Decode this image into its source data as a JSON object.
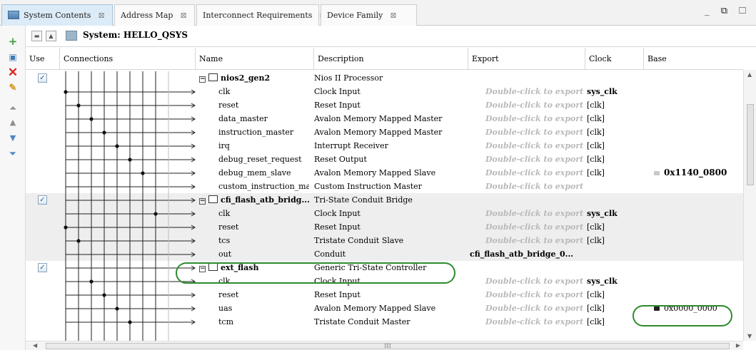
{
  "tabs": [
    {
      "label": "System Contents",
      "close": "⊠"
    },
    {
      "label": "Address Map",
      "close": "⊠"
    },
    {
      "label": "Interconnect Requirements",
      "close": "⊠"
    },
    {
      "label": "Device Family",
      "close": "⊠"
    }
  ],
  "window_controls": "_ ⧉ ☐",
  "system": {
    "label": "System: HELLO_QSYS"
  },
  "toolbar_icons": [
    "add-icon",
    "add-component-icon",
    "remove-icon",
    "edit-icon",
    "move-to-top-icon",
    "move-up-icon",
    "move-down-icon",
    "move-to-bottom-icon"
  ],
  "columns": {
    "use": "Use",
    "connections": "Connections",
    "name": "Name",
    "description": "Description",
    "export": "Export",
    "clock": "Clock",
    "base": "Base"
  },
  "export_hint": "Double-click to export",
  "rows": [
    {
      "name": "nios2_gen2",
      "description": "Nios II Processor",
      "main": true,
      "checked": true
    },
    {
      "name": "clk",
      "description": "Clock Input",
      "export_hint": true,
      "clock": "sys_clk",
      "clock_bold": true
    },
    {
      "name": "reset",
      "description": "Reset Input",
      "export_hint": true,
      "clock": "[clk]"
    },
    {
      "name": "data_master",
      "description": "Avalon Memory Mapped Master",
      "export_hint": true,
      "clock": "[clk]"
    },
    {
      "name": "instruction_master",
      "description": "Avalon Memory Mapped Master",
      "export_hint": true,
      "clock": "[clk]"
    },
    {
      "name": "irq",
      "description": "Interrupt Receiver",
      "export_hint": true,
      "clock": "[clk]"
    },
    {
      "name": "debug_reset_request",
      "description": "Reset Output",
      "export_hint": true,
      "clock": "[clk]"
    },
    {
      "name": "debug_mem_slave",
      "description": "Avalon Memory Mapped Slave",
      "export_hint": true,
      "clock": "[clk]",
      "base": "0x1140_0800",
      "base_bold": true,
      "lock": "light"
    },
    {
      "name": "custom_instruction_ma...",
      "description": "Custom Instruction Master",
      "export_hint": true
    },
    {
      "name": "cfi_flash_atb_bridg...",
      "description": "Tri-State Conduit Bridge",
      "main": true,
      "checked": true
    },
    {
      "name": "clk",
      "description": "Clock Input",
      "export_hint": true,
      "clock": "sys_clk",
      "clock_bold": true
    },
    {
      "name": "reset",
      "description": "Reset Input",
      "export_hint": true,
      "clock": "[clk]"
    },
    {
      "name": "tcs",
      "description": "Tristate Conduit Slave",
      "export_hint": true,
      "clock": "[clk]"
    },
    {
      "name": "out",
      "description": "Conduit",
      "export": "cfi_flash_atb_bridge_0..."
    },
    {
      "name": "ext_flash",
      "description": "Generic Tri-State Controller",
      "main": true,
      "checked": true
    },
    {
      "name": "clk",
      "description": "Clock Input",
      "export_hint": true,
      "clock": "sys_clk",
      "clock_bold": true
    },
    {
      "name": "reset",
      "description": "Reset Input",
      "export_hint": true,
      "clock": "[clk]"
    },
    {
      "name": "uas",
      "description": "Avalon Memory Mapped Slave",
      "export_hint": true,
      "clock": "[clk]",
      "base": "0x0000_0000",
      "lock": "dark"
    },
    {
      "name": "tcm",
      "description": "Tristate Conduit Master",
      "export_hint": true,
      "clock": "[clk]"
    }
  ],
  "hscroll_grip": "III"
}
